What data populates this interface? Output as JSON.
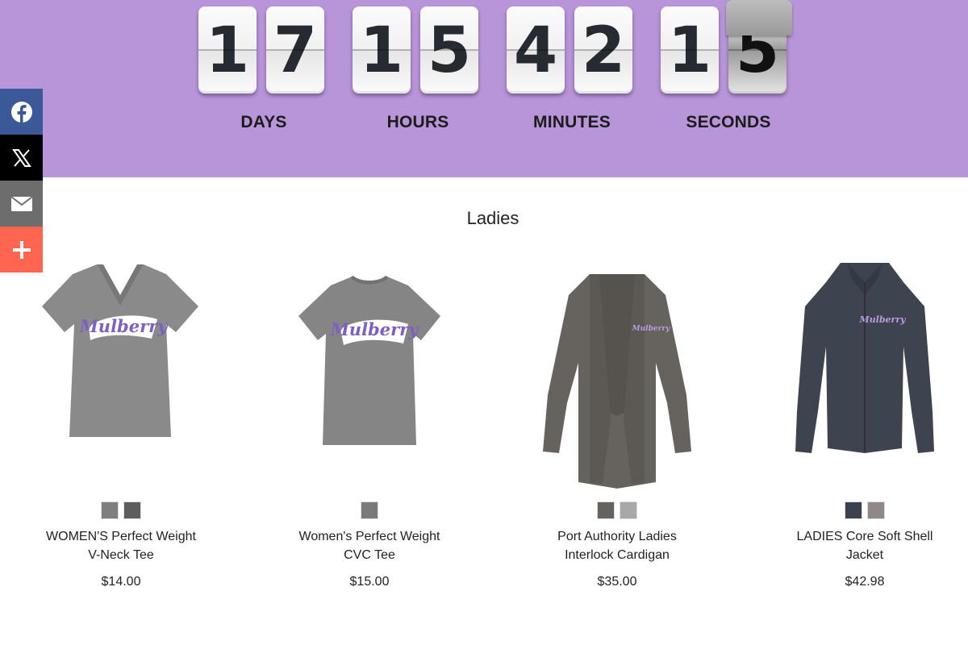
{
  "countdown": {
    "days": [
      "1",
      "7"
    ],
    "hours": [
      "1",
      "5"
    ],
    "minutes": [
      "4",
      "2"
    ],
    "seconds": [
      "1",
      "5"
    ],
    "labels": {
      "days": "DAYS",
      "hours": "HOURS",
      "minutes": "MINUTES",
      "seconds": "SECONDS"
    }
  },
  "social": [
    {
      "name": "facebook",
      "icon": "facebook-icon",
      "color": "#3b5998"
    },
    {
      "name": "x",
      "icon": "x-icon",
      "color": "#000000"
    },
    {
      "name": "email",
      "icon": "mail-icon",
      "color": "#6d6d6d"
    },
    {
      "name": "more",
      "icon": "plus-icon",
      "color": "#ff6550"
    }
  ],
  "section": {
    "title": "Ladies"
  },
  "products": [
    {
      "line1": "WOMEN'S Perfect Weight",
      "line2": "V-Neck Tee",
      "price": "$14.00",
      "swatches": [
        "#7e7e7e",
        "#5d5d5d"
      ],
      "image": "gray-vneck-tee"
    },
    {
      "line1": "Women's Perfect Weight",
      "line2": "CVC Tee",
      "price": "$15.00",
      "swatches": [
        "#7a7a7a"
      ],
      "image": "gray-crew-tee"
    },
    {
      "line1": "Port Authority Ladies",
      "line2": "Interlock Cardigan",
      "price": "$35.00",
      "swatches": [
        "#66625e",
        "#a8a8a8"
      ],
      "image": "gray-cardigan"
    },
    {
      "line1": "LADIES Core Soft Shell",
      "line2": "Jacket",
      "price": "$42.98",
      "swatches": [
        "#3c4150",
        "#8f8885"
      ],
      "image": "navy-softshell-jacket"
    }
  ],
  "logo_text": "Mulberry"
}
